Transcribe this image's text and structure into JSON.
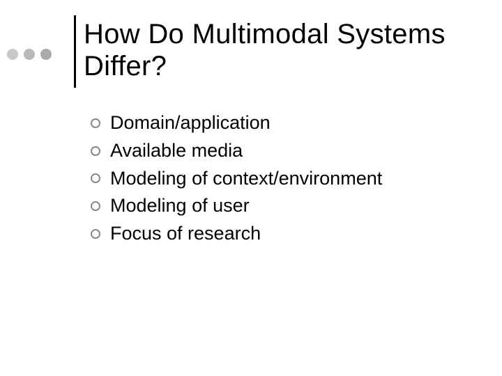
{
  "title": "How Do Multimodal Systems Differ?",
  "bullets": [
    {
      "text": "Domain/application"
    },
    {
      "text": "Available media"
    },
    {
      "text": "Modeling of context/environment"
    },
    {
      "text": "Modeling of user"
    },
    {
      "text": "Focus of research"
    }
  ]
}
